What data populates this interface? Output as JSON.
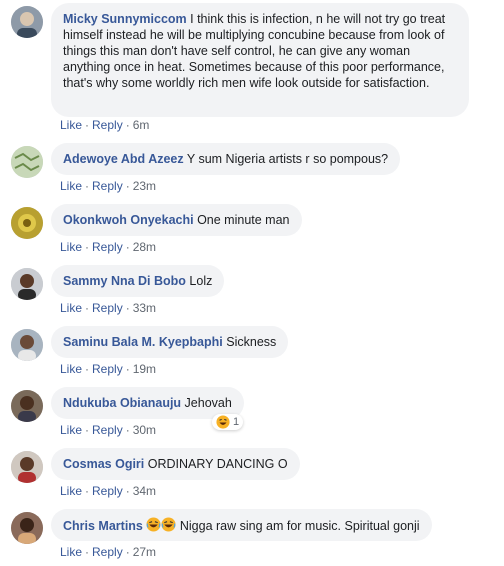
{
  "comments": [
    {
      "name": "Micky Sunnymiccom",
      "text": "I think this is infection, n he will not try go treat himself instead he will be multiplying concubine because from look of things this man don't have self control, he can give any woman anything once in heat. Sometimes because of this poor performance, that's why some worldly rich men wife look outside for satisfaction.",
      "like": "Like",
      "reply": "Reply",
      "time": "6m"
    },
    {
      "name": "Adewoye Abd Azeez",
      "text": "Y sum Nigeria artists r so pompous?",
      "like": "Like",
      "reply": "Reply",
      "time": "23m"
    },
    {
      "name": "Okonkwoh Onyekachi",
      "text": "One minute man",
      "like": "Like",
      "reply": "Reply",
      "time": "28m"
    },
    {
      "name": "Sammy Nna Di Bobo",
      "text": "Lolz",
      "like": "Like",
      "reply": "Reply",
      "time": "33m"
    },
    {
      "name": "Saminu Bala M. Kyepbaphi",
      "text": "Sickness",
      "like": "Like",
      "reply": "Reply",
      "time": "19m"
    },
    {
      "name": "Ndukuba Obianauju",
      "text": "Jehovah",
      "like": "Like",
      "reply": "Reply",
      "time": "30m",
      "reaction_count": "1",
      "reaction_icon": "haha-icon"
    },
    {
      "name": "Cosmas Ogiri",
      "text": "ORDINARY DANCING O",
      "like": "Like",
      "reply": "Reply",
      "time": "34m"
    },
    {
      "name": "Chris Martins",
      "text": "Nigga raw sing am for music. Spiritual gonji",
      "like": "Like",
      "reply": "Reply",
      "time": "27m",
      "emoji_icon": "laughing-emoji-icon"
    }
  ],
  "colors": {
    "name": "#385898",
    "bubble": "#f2f3f5",
    "meta": "#606770"
  }
}
